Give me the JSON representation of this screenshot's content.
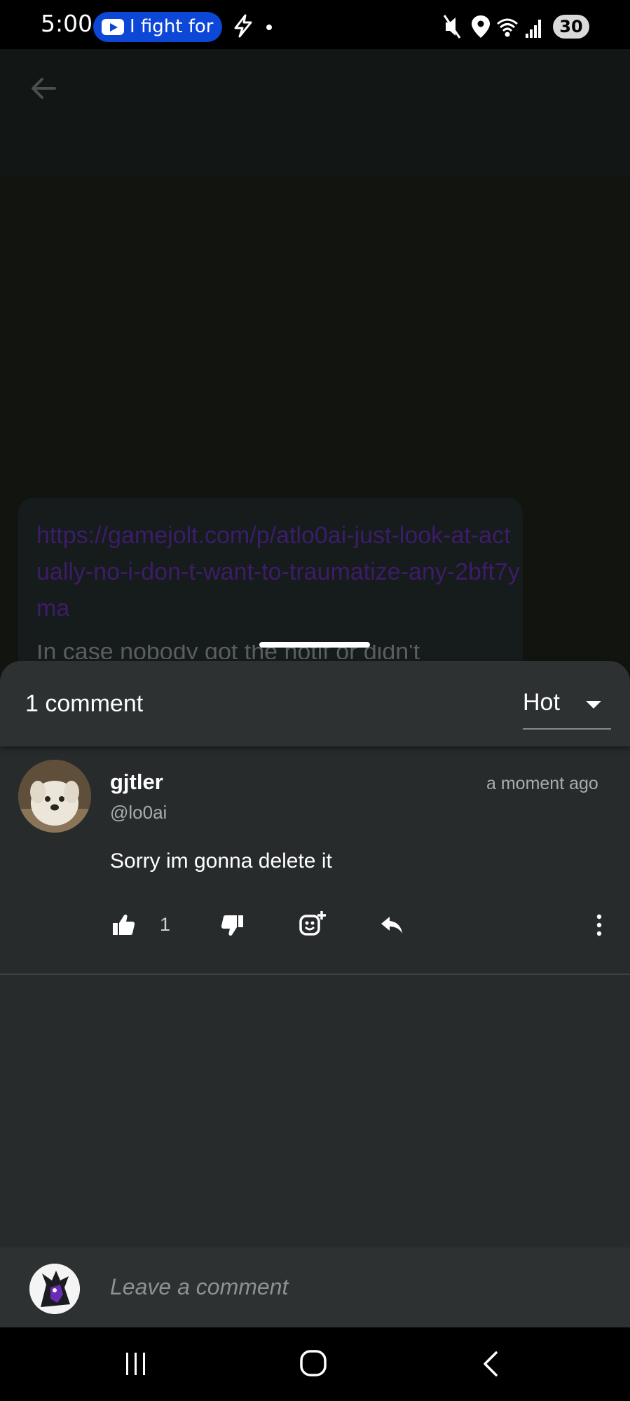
{
  "status_bar": {
    "time": "5:00",
    "media_pill_text": "I fight for",
    "battery": "30"
  },
  "post": {
    "link": "https://gamejolt.com/p/atlo0ai-just-look-at-actually-no-i-don-t-want-to-traumatize-any-2bft7yma",
    "peek_text": "In case nobody got the notif or didn't"
  },
  "comments_sheet": {
    "count_label": "1 comment",
    "sort": {
      "selected": "Hot"
    },
    "comments": [
      {
        "author": "gjtler",
        "handle": "@lo0ai",
        "time": "a moment ago",
        "text": "Sorry im gonna delete it",
        "likes": "1"
      }
    ]
  },
  "input": {
    "placeholder": "Leave a comment"
  },
  "colors": {
    "sheet": "#272b2b",
    "header": "#2d3131",
    "link": "#3d1c6a",
    "muted": "#a8acac"
  }
}
